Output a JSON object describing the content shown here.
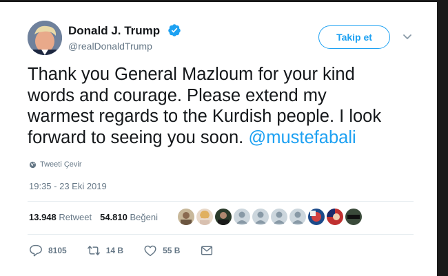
{
  "user": {
    "name": "Donald J. Trump",
    "handle": "@realDonaldTrump"
  },
  "follow_button": "Takip et",
  "tweet": {
    "lines": [
      "Thank you General Mazloum for your kind",
      "words and courage. Please extend my",
      "warmest regards to the Kurdish people. I look",
      "forward to seeing you soon. "
    ],
    "mention": "@mustefabali"
  },
  "translate_label": "Tweeti Çevir",
  "timestamp": "19:35 - 23 Eki 2019",
  "stats": {
    "retweet_count": "13.948",
    "retweet_label": "Retweet",
    "like_count": "54.810",
    "like_label": "Beğeni"
  },
  "likers_count": 10,
  "actions": {
    "replies": "8105",
    "retweets": "14 B",
    "likes": "55 B"
  },
  "colors": {
    "accent": "#1da1f2",
    "muted": "#657786",
    "text": "#14171a"
  },
  "icons": [
    "verified-badge-icon",
    "chevron-down-icon",
    "globe-icon",
    "reply-icon",
    "retweet-icon",
    "heart-icon",
    "message-icon"
  ]
}
